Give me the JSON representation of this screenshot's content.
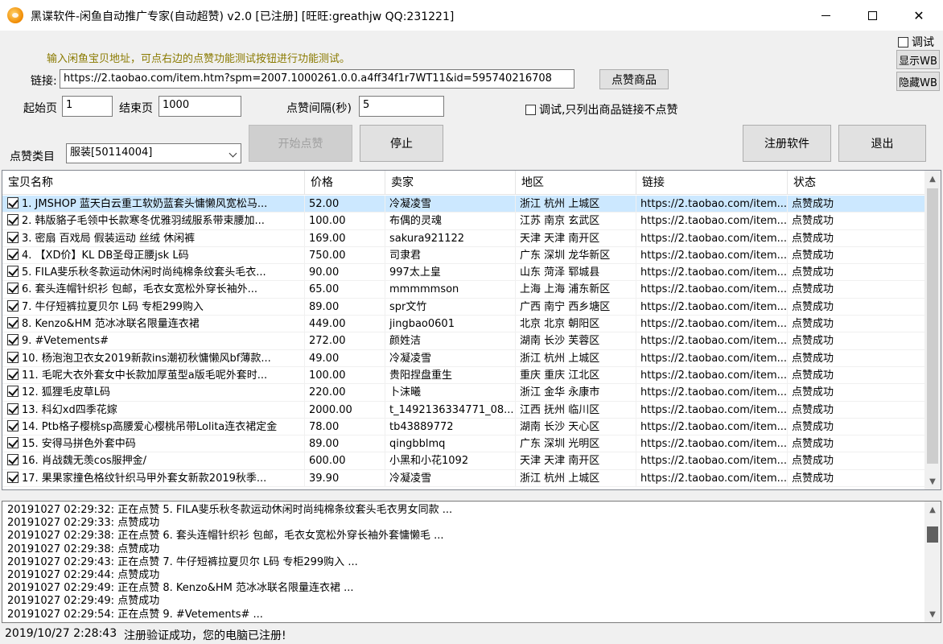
{
  "window": {
    "title": "黑谍软件-闲鱼自动推广专家(自动超赞)  v2.0 [已注册] [旺旺:greathjw QQ:231221]",
    "minimize": "—",
    "maximize": "☐",
    "close": "✕"
  },
  "form": {
    "hint": "输入闲鱼宝贝地址，可点右边的点赞功能测试按钮进行功能测试。",
    "link_label": "链接:",
    "link_value": "https://2.taobao.com/item.htm?spm=2007.1000261.0.0.a4ff34f1r7WT11&id=595740216708",
    "like_product_button": "点赞商品",
    "start_page_label": "起始页",
    "start_page_value": "1",
    "end_page_label": "结束页",
    "end_page_value": "1000",
    "interval_label": "点赞间隔(秒)",
    "interval_value": "5",
    "debug_list_label": "调试,只列出商品链接不点赞",
    "category_label": "点赞类目",
    "category_value": "服装[50114004]",
    "start_button": "开始点赞",
    "stop_button": "停止",
    "register_button": "注册软件",
    "exit_button": "退出"
  },
  "side": {
    "debug_label": "调试",
    "show_wb": "显示WB",
    "hide_wb": "隐藏WB"
  },
  "table": {
    "headers": [
      "宝贝名称",
      "价格",
      "卖家",
      "地区",
      "链接",
      "状态"
    ],
    "rows": [
      [
        "1. JMSHOP 蓝天白云重工软奶蓝套头慵懒风宽松马...",
        "52.00",
        "冷凝凌雪",
        "浙江 杭州 上城区",
        "https://2.taobao.com/item...",
        "点赞成功"
      ],
      [
        "2. 韩版貉子毛领中长款寒冬优雅羽绒服系带束腰加...",
        "100.00",
        "布偶的灵魂",
        "江苏 南京 玄武区",
        "https://2.taobao.com/item...",
        "点赞成功"
      ],
      [
        "3. 密扇 百戏局 假装运动 丝绒 休闲裤",
        "169.00",
        "sakura921122",
        "天津 天津 南开区",
        "https://2.taobao.com/item...",
        "点赞成功"
      ],
      [
        "4. 【XD价】KL DB圣母正腰jsk L码",
        "750.00",
        "司隶君",
        "广东 深圳 龙华新区",
        "https://2.taobao.com/item...",
        "点赞成功"
      ],
      [
        "5. FILA斐乐秋冬款运动休闲时尚纯棉条纹套头毛衣...",
        "90.00",
        "997太上皇",
        "山东 菏泽 郓城县",
        "https://2.taobao.com/item...",
        "点赞成功"
      ],
      [
        "6. 套头连帽针织衫 包邮，毛衣女宽松外穿长袖外...",
        "65.00",
        "mmmmmson",
        "上海 上海 浦东新区",
        "https://2.taobao.com/item...",
        "点赞成功"
      ],
      [
        "7. 牛仔短裤拉夏贝尔 L码 专柜299购入",
        "89.00",
        "spr文竹",
        "广西 南宁 西乡塘区",
        "https://2.taobao.com/item...",
        "点赞成功"
      ],
      [
        "8. Kenzo&HM 范冰冰联名限量连衣裙",
        "449.00",
        "jingbao0601",
        "北京 北京 朝阳区",
        "https://2.taobao.com/item...",
        "点赞成功"
      ],
      [
        "9. #Vetements#",
        "272.00",
        "颜姓洁",
        "湖南 长沙 芙蓉区",
        "https://2.taobao.com/item...",
        "点赞成功"
      ],
      [
        "10. 杨泡泡卫衣女2019新款ins潮初秋慵懒风bf薄款...",
        "49.00",
        "冷凝凌雪",
        "浙江 杭州 上城区",
        "https://2.taobao.com/item...",
        "点赞成功"
      ],
      [
        "11. 毛呢大衣外套女中长款加厚茧型a版毛呢外套时...",
        "100.00",
        "贵阳捏盘重生",
        "重庆 重庆 江北区",
        "https://2.taobao.com/item...",
        "点赞成功"
      ],
      [
        "12. 狐狸毛皮草L码",
        "220.00",
        "卜沫曦",
        "浙江 金华 永康市",
        "https://2.taobao.com/item...",
        "点赞成功"
      ],
      [
        "13. 科幻xd四季花嫁",
        "2000.00",
        "t_1492136334771_08...",
        "江西 抚州 临川区",
        "https://2.taobao.com/item...",
        "点赞成功"
      ],
      [
        "14. Ptb格子樱桃sp高腰爱心樱桃吊带Lolita连衣裙定金",
        "78.00",
        "tb43889772",
        "湖南 长沙 天心区",
        "https://2.taobao.com/item...",
        "点赞成功"
      ],
      [
        "15. 安得马拼色外套中码",
        "89.00",
        "qingbblmq",
        "广东 深圳 光明区",
        "https://2.taobao.com/item...",
        "点赞成功"
      ],
      [
        "16. 肖战魏无羡cos服押金/",
        "600.00",
        "小黑和小花1092",
        "天津 天津 南开区",
        "https://2.taobao.com/item...",
        "点赞成功"
      ],
      [
        "17. 果果家撞色格纹针织马甲外套女新款2019秋季...",
        "39.90",
        "冷凝凌雪",
        "浙江 杭州 上城区",
        "https://2.taobao.com/item...",
        "点赞成功"
      ]
    ]
  },
  "log": [
    "20191027 02:29:32:  正在点赞 5. FILA斐乐秋冬款运动休闲时尚纯棉条纹套头毛衣男女同款 ...",
    "20191027 02:29:33:  点赞成功",
    "20191027 02:29:38:  正在点赞 6. 套头连帽针织衫 包邮，毛衣女宽松外穿长袖外套慵懒毛 ...",
    "20191027 02:29:38:  点赞成功",
    "20191027 02:29:43:  正在点赞 7. 牛仔短裤拉夏贝尔 L码 专柜299购入 ...",
    "20191027 02:29:44:  点赞成功",
    "20191027 02:29:49:  正在点赞 8. Kenzo&HM 范冰冰联名限量连衣裙 ...",
    "20191027 02:29:49:  点赞成功",
    "20191027 02:29:54:  正在点赞 9. #Vetements# ..."
  ],
  "status": {
    "time": "2019/10/27 2:28:43",
    "message": "注册验证成功，您的电脑已注册!"
  }
}
